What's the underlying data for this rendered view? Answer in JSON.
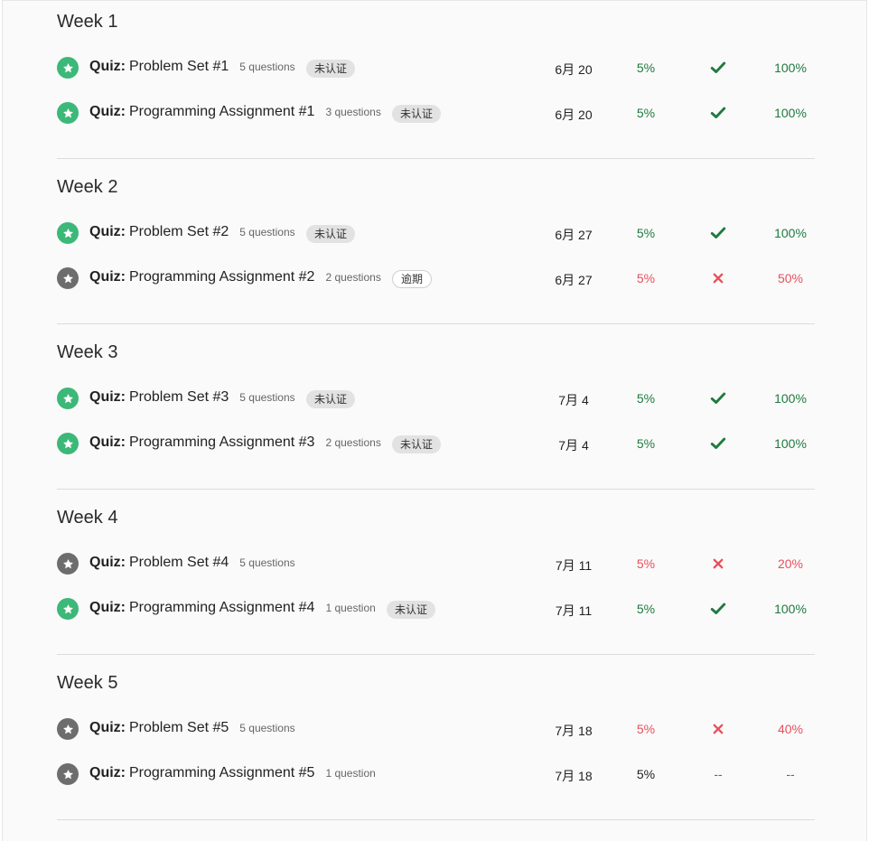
{
  "colors": {
    "pass": "#3cb878",
    "fail": "#6d6d6d",
    "green_text": "#1f7a3f",
    "red_text": "#e8505b"
  },
  "weeks": [
    {
      "title": "Week 1",
      "items": [
        {
          "status": "pass",
          "status_icon": "star-icon",
          "kind": "Quiz:",
          "name": "Problem Set #1",
          "meta": "5 questions",
          "badge": "未认证",
          "badge_type": "unverified",
          "date": "6月 20",
          "weight": "5%",
          "weight_color": "green",
          "result": "check",
          "grade": "100%",
          "grade_color": "green"
        },
        {
          "status": "pass",
          "status_icon": "star-icon",
          "kind": "Quiz:",
          "name": "Programming Assignment #1",
          "meta": "3 questions",
          "badge": "未认证",
          "badge_type": "unverified",
          "date": "6月 20",
          "weight": "5%",
          "weight_color": "green",
          "result": "check",
          "grade": "100%",
          "grade_color": "green"
        }
      ]
    },
    {
      "title": "Week 2",
      "items": [
        {
          "status": "pass",
          "status_icon": "star-icon",
          "kind": "Quiz:",
          "name": "Problem Set #2",
          "meta": "5 questions",
          "badge": "未认证",
          "badge_type": "unverified",
          "date": "6月 27",
          "weight": "5%",
          "weight_color": "green",
          "result": "check",
          "grade": "100%",
          "grade_color": "green"
        },
        {
          "status": "fail",
          "status_icon": "star-icon",
          "kind": "Quiz:",
          "name": "Programming Assignment #2",
          "meta": "2 questions",
          "badge": "逾期",
          "badge_type": "overdue",
          "date": "6月 27",
          "weight": "5%",
          "weight_color": "red",
          "result": "cross",
          "grade": "50%",
          "grade_color": "red"
        }
      ]
    },
    {
      "title": "Week 3",
      "items": [
        {
          "status": "pass",
          "status_icon": "star-icon",
          "kind": "Quiz:",
          "name": "Problem Set #3",
          "meta": "5 questions",
          "badge": "未认证",
          "badge_type": "unverified",
          "date": "7月 4",
          "weight": "5%",
          "weight_color": "green",
          "result": "check",
          "grade": "100%",
          "grade_color": "green"
        },
        {
          "status": "pass",
          "status_icon": "star-icon",
          "kind": "Quiz:",
          "name": "Programming Assignment #3",
          "meta": "2 questions",
          "badge": "未认证",
          "badge_type": "unverified",
          "date": "7月 4",
          "weight": "5%",
          "weight_color": "green",
          "result": "check",
          "grade": "100%",
          "grade_color": "green"
        }
      ]
    },
    {
      "title": "Week 4",
      "items": [
        {
          "status": "fail",
          "status_icon": "star-icon",
          "kind": "Quiz:",
          "name": "Problem Set #4",
          "meta": "5 questions",
          "badge": "",
          "badge_type": "",
          "date": "7月 11",
          "weight": "5%",
          "weight_color": "red",
          "result": "cross",
          "grade": "20%",
          "grade_color": "red"
        },
        {
          "status": "pass",
          "status_icon": "star-icon",
          "kind": "Quiz:",
          "name": "Programming Assignment #4",
          "meta": "1 question",
          "badge": "未认证",
          "badge_type": "unverified",
          "date": "7月 11",
          "weight": "5%",
          "weight_color": "green",
          "result": "check",
          "grade": "100%",
          "grade_color": "green"
        }
      ]
    },
    {
      "title": "Week 5",
      "items": [
        {
          "status": "fail",
          "status_icon": "star-icon",
          "kind": "Quiz:",
          "name": "Problem Set #5",
          "meta": "5 questions",
          "badge": "",
          "badge_type": "",
          "date": "7月 18",
          "weight": "5%",
          "weight_color": "red",
          "result": "cross",
          "grade": "40%",
          "grade_color": "red"
        },
        {
          "status": "fail",
          "status_icon": "star-icon",
          "kind": "Quiz:",
          "name": "Programming Assignment #5",
          "meta": "1 question",
          "badge": "",
          "badge_type": "",
          "date": "7月 18",
          "weight": "5%",
          "weight_color": "dark",
          "result": "--",
          "grade": "--",
          "grade_color": "muted"
        }
      ]
    }
  ]
}
